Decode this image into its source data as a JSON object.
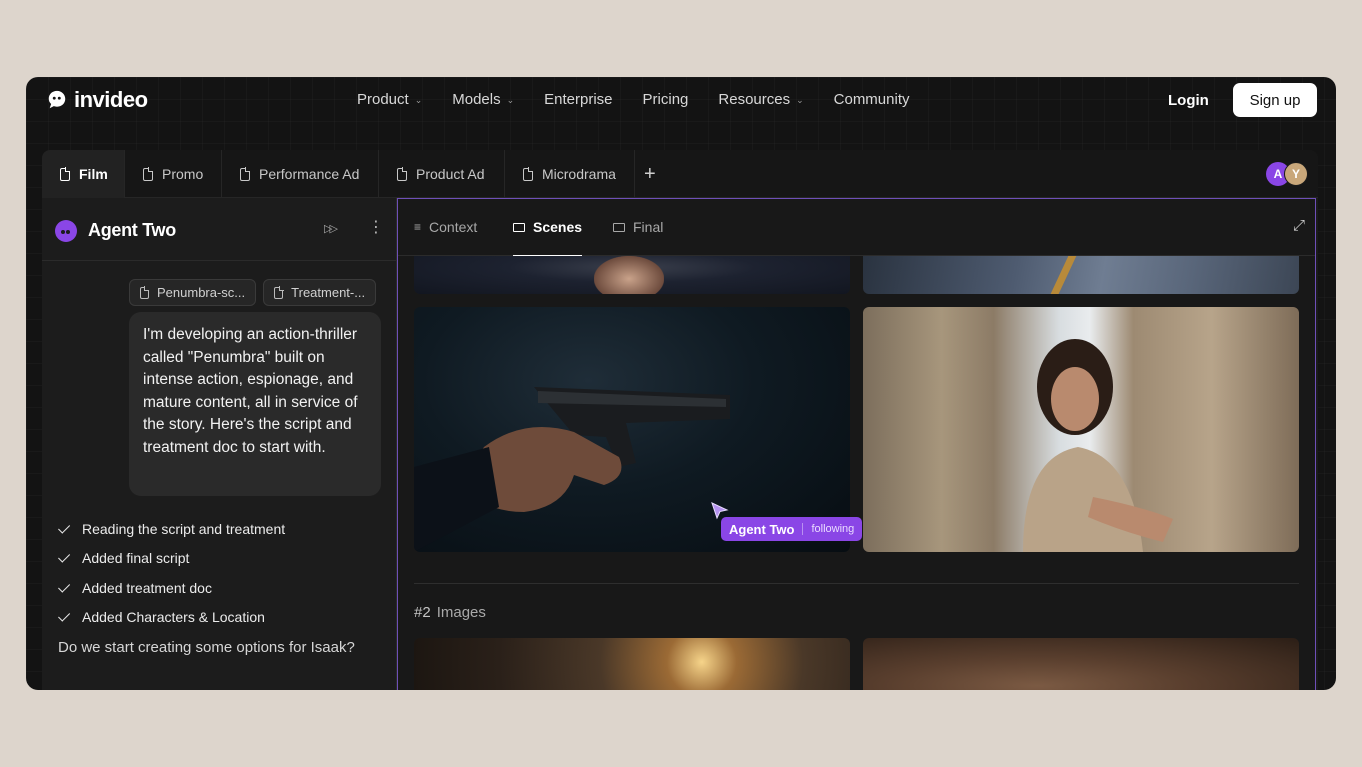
{
  "brand": {
    "name": "invideo"
  },
  "nav": {
    "links": [
      {
        "label": "Product",
        "dropdown": true
      },
      {
        "label": "Models",
        "dropdown": true
      },
      {
        "label": "Enterprise",
        "dropdown": false
      },
      {
        "label": "Pricing",
        "dropdown": false
      },
      {
        "label": "Resources",
        "dropdown": true
      },
      {
        "label": "Community",
        "dropdown": false
      }
    ],
    "login": "Login",
    "signup": "Sign up"
  },
  "tabs": [
    {
      "label": "Film",
      "active": true
    },
    {
      "label": "Promo"
    },
    {
      "label": "Performance Ad"
    },
    {
      "label": "Product Ad"
    },
    {
      "label": "Microdrama"
    }
  ],
  "avatars": [
    "A",
    "Y"
  ],
  "agent": {
    "name": "Agent Two",
    "attachments": [
      "Penumbra-sc...",
      "Treatment-..."
    ],
    "user_message": "I'm developing an action-thriller called \"Penumbra\" built on intense action, espionage, and mature content, all in service of the story. Here's the script and treatment doc to start with.",
    "steps": [
      "Reading the script and treatment",
      "Added final script",
      "Added treatment doc",
      "Added Characters & Location"
    ],
    "question": "Do we start creating some options for Isaak?"
  },
  "workspace": {
    "subtabs": [
      {
        "label": "Context",
        "icon": "lines-icon"
      },
      {
        "label": "Scenes",
        "icon": "folder-icon",
        "active": true
      },
      {
        "label": "Final",
        "icon": "folder-icon"
      }
    ],
    "cursor_tag": {
      "name": "Agent Two",
      "status": "following"
    },
    "section": {
      "number": "#2",
      "title": "Images"
    }
  },
  "colors": {
    "accent": "#8a46e6",
    "frame_border": "#6e4fb8",
    "background": "#ddd5cc"
  }
}
